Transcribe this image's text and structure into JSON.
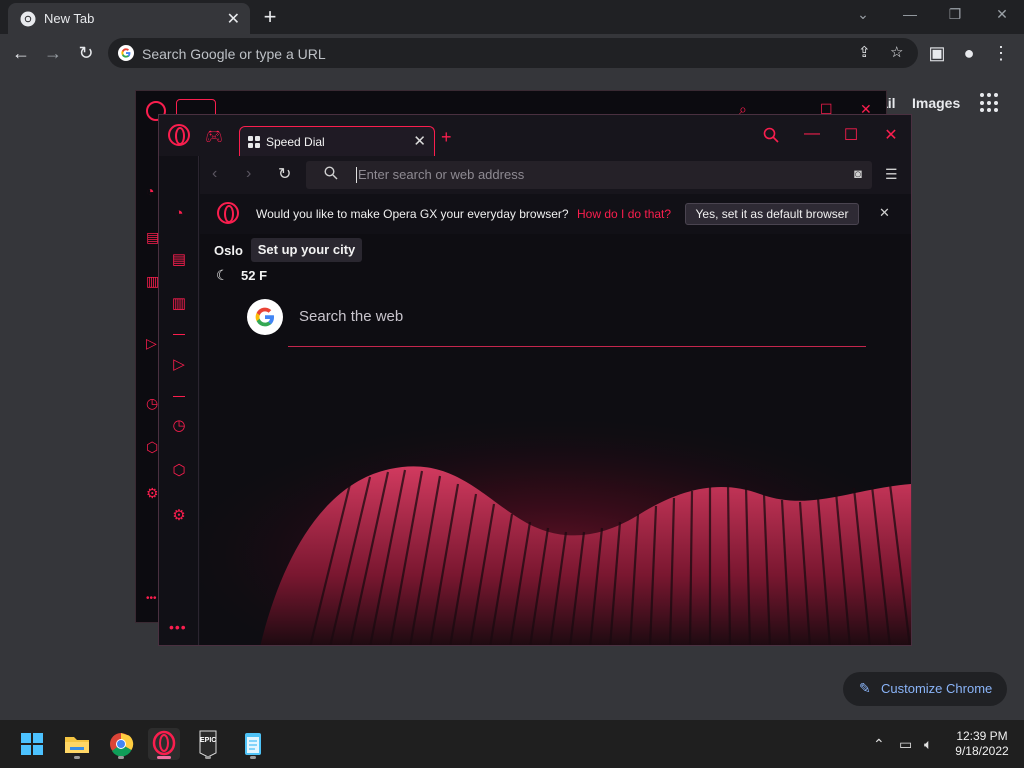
{
  "chrome": {
    "tab_title": "New Tab",
    "tab_close": "✕",
    "new_tab": "+",
    "omnibox_placeholder": "Search Google or type a URL",
    "ntp_links": [
      "ail",
      "Images"
    ],
    "customize_label": "Customize Chrome"
  },
  "opera": {
    "active_tab_title": "Speed Dial",
    "address_placeholder": "Enter search or web address",
    "banner_question": "Would you like to make Opera GX your everyday browser?",
    "banner_how": "How do I do that?",
    "banner_yes": "Yes, set it as default browser",
    "city": "Oslo",
    "city_tip": "Set up your city",
    "temperature": "52 F",
    "web_search_placeholder": "Search the web",
    "more_dots": "•••",
    "accent_color": "#fa1e4e",
    "sidebar_icons": [
      "speedometer-icon",
      "shopping-bag-icon",
      "twitch-icon",
      "play-icon",
      "clock-icon",
      "cube-icon",
      "gear-icon"
    ]
  },
  "taskbar": {
    "time": "12:39 PM",
    "date": "9/18/2022",
    "apps": [
      "windows-start-icon",
      "file-explorer-icon",
      "chrome-icon",
      "opera-gx-icon",
      "epic-games-icon",
      "notepad-icon"
    ],
    "epic_label": "EPIC"
  }
}
